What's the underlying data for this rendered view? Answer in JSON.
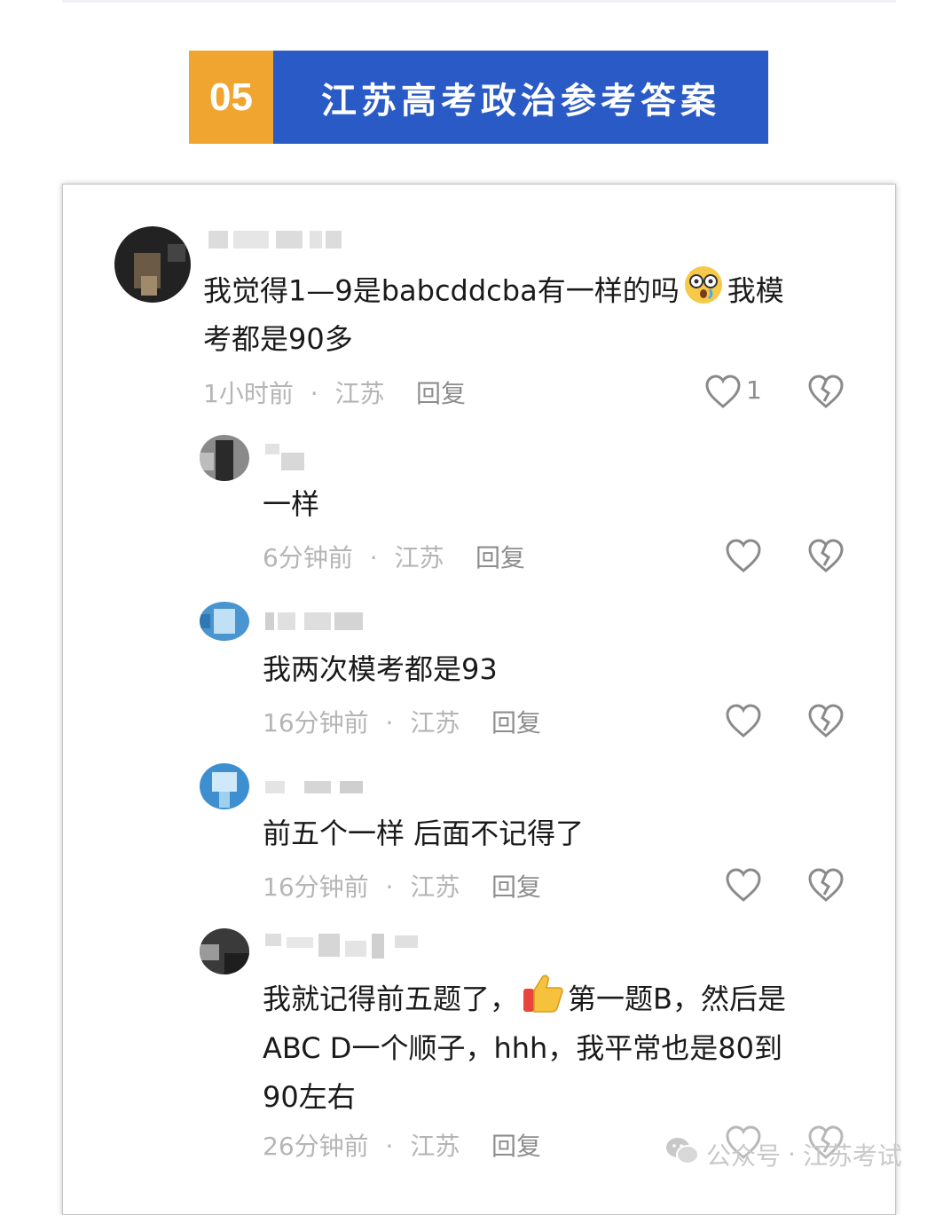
{
  "banner": {
    "number": "05",
    "title": "江苏高考政治参考答案"
  },
  "comments": [
    {
      "text_line1": "我觉得1—9是babcddcba有一样的吗",
      "emoji": "astonished-face-emoji",
      "text_line1_tail": "我模",
      "text_line2": "考都是90多",
      "time": "1小时前",
      "location": "江苏",
      "reply": "回复",
      "likes": "1"
    },
    {
      "text": "一样",
      "time": "6分钟前",
      "location": "江苏",
      "reply": "回复"
    },
    {
      "text": "我两次模考都是93",
      "time": "16分钟前",
      "location": "江苏",
      "reply": "回复"
    },
    {
      "text": "前五个一样 后面不记得了",
      "time": "16分钟前",
      "location": "江苏",
      "reply": "回复"
    },
    {
      "text_line1": "我就记得前五题了，",
      "emoji": "thumbs-up-emoji",
      "text_line1_tail": "第一题B，然后是",
      "text_line2": "ABC D一个顺子，hhh，我平常也是80到",
      "text_line3": "90左右",
      "time": "26分钟前",
      "location": "江苏",
      "reply": "回复"
    }
  ],
  "separator": "·",
  "watermark": {
    "prefix": "公众号",
    "dot": "·",
    "name": "江苏考试"
  },
  "colors": {
    "banner_orange": "#f0a531",
    "banner_blue": "#2a5ac6",
    "meta_gray": "#b5b5b5"
  },
  "icons": [
    "heart-outline-icon",
    "broken-heart-icon",
    "wechat-icon"
  ]
}
